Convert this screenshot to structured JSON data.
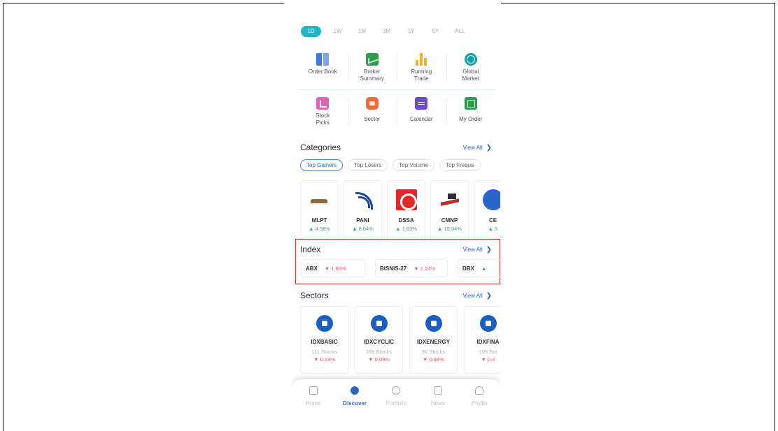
{
  "timeframes": [
    {
      "label": "1D",
      "active": true
    },
    {
      "label": "1W",
      "active": false
    },
    {
      "label": "1M",
      "active": false
    },
    {
      "label": "3M",
      "active": false
    },
    {
      "label": "1Y",
      "active": false
    },
    {
      "label": "5Y",
      "active": false
    },
    {
      "label": "ALL",
      "active": false
    }
  ],
  "menu": {
    "row1": [
      {
        "label": "Order Book",
        "icon": "order-book-icon"
      },
      {
        "label": "Broker Summary",
        "icon": "broker-summary-icon"
      },
      {
        "label": "Running Trade",
        "icon": "running-trade-icon"
      },
      {
        "label": "Global Market",
        "icon": "global-market-icon"
      }
    ],
    "row2": [
      {
        "label": "Stock Picks",
        "icon": "stock-picks-icon"
      },
      {
        "label": "Sector",
        "icon": "sector-icon"
      },
      {
        "label": "Calendar",
        "icon": "calendar-icon"
      },
      {
        "label": "My Order",
        "icon": "my-order-icon"
      }
    ]
  },
  "categories": {
    "title": "Categories",
    "view_all": "View All",
    "chips": [
      "Top Gainers",
      "Top Losers",
      "Top Volume",
      "Top Freque"
    ],
    "stocks": [
      {
        "code": "MLPT",
        "change": "▲ 4.58%"
      },
      {
        "code": "PANI",
        "change": "▲ 8.04%"
      },
      {
        "code": "DSSA",
        "change": "▲ 1.63%"
      },
      {
        "code": "CMNP",
        "change": "▲ 15.04%"
      },
      {
        "code": "CE",
        "change": "▲ 5"
      }
    ]
  },
  "index": {
    "title": "Index",
    "view_all": "View All",
    "items": [
      {
        "name": "ABX",
        "change": "▼ 1.60%",
        "direction": "down"
      },
      {
        "name": "BISNIS-27",
        "change": "▼ 1.24%",
        "direction": "down"
      },
      {
        "name": "DBX",
        "change": "▲",
        "direction": "up"
      }
    ]
  },
  "sectors": {
    "title": "Sectors",
    "view_all": "View All",
    "items": [
      {
        "code": "IDXBASIC",
        "count": "111 Stocks",
        "change": "▼ 0.23%"
      },
      {
        "code": "IDXCYCLIC",
        "count": "165 Stocks",
        "change": "▼ 0.09%"
      },
      {
        "code": "IDXENERGY",
        "count": "90 Stocks",
        "change": "▼ 0.84%"
      },
      {
        "code": "IDXFINA",
        "count": "105 Sto",
        "change": "▼ 0.4"
      }
    ]
  },
  "nav": [
    {
      "label": "Home",
      "icon": "home-icon",
      "active": false
    },
    {
      "label": "Discover",
      "icon": "discover-icon",
      "active": true
    },
    {
      "label": "Portfolio",
      "icon": "portfolio-icon",
      "active": false
    },
    {
      "label": "News",
      "icon": "news-icon",
      "active": false
    },
    {
      "label": "Profile",
      "icon": "profile-icon",
      "active": false
    }
  ],
  "colors": {
    "accent_teal": "#1fb4c6",
    "link_blue": "#2a66c9",
    "gain_green": "#2fa46a",
    "loss_red": "#e05a6a",
    "highlight_box": "#e03434"
  }
}
